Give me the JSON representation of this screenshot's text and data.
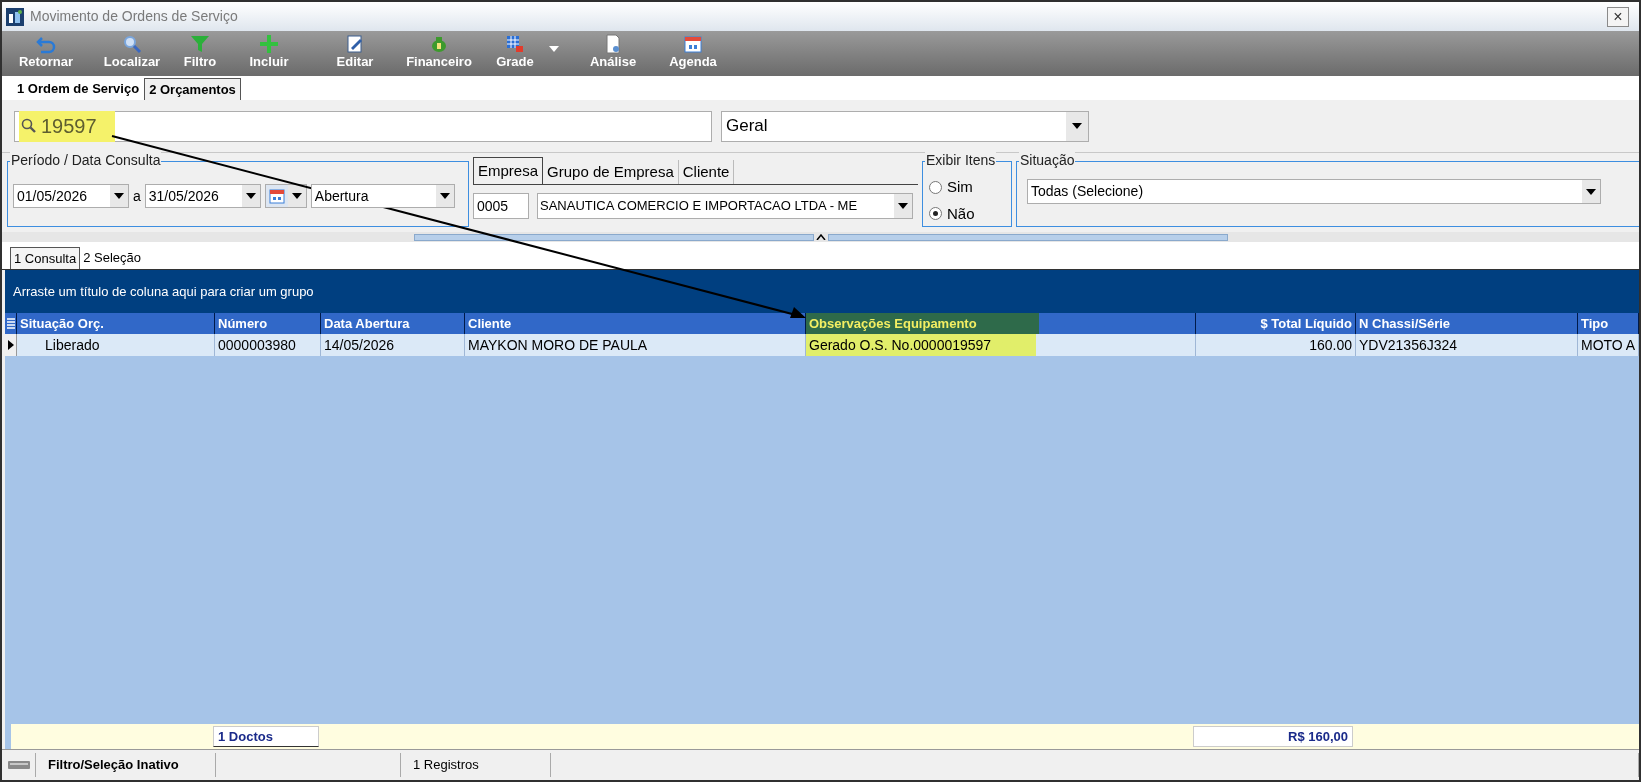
{
  "window": {
    "title": "Movimento de Ordens de Serviço",
    "close": "×"
  },
  "toolbar": [
    {
      "label": "Retornar",
      "dropdown": false
    },
    {
      "label": "Localizar",
      "dropdown": false
    },
    {
      "label": "Filtro",
      "dropdown": false
    },
    {
      "label": "Incluir",
      "dropdown": false
    },
    {
      "label": "Editar",
      "dropdown": false
    },
    {
      "label": "Financeiro",
      "dropdown": false
    },
    {
      "label": "Grade",
      "dropdown": true
    },
    {
      "label": "Análise",
      "dropdown": false
    },
    {
      "label": "Agenda",
      "dropdown": false
    }
  ],
  "tabs": [
    {
      "label": "1 Ordem de Serviço",
      "selected": false
    },
    {
      "label": "2 Orçamentos",
      "selected": true
    }
  ],
  "search": {
    "value": "19597",
    "highlighted": true
  },
  "scope_dropdown": {
    "value": "Geral"
  },
  "period": {
    "title": "Período / Data Consulta",
    "from": "01/05/2026",
    "separator": "a",
    "to": "31/05/2026",
    "date_type": "Abertura"
  },
  "company_tabs": [
    {
      "label": "Empresa",
      "selected": true
    },
    {
      "label": "Grupo de Empresa",
      "selected": false
    },
    {
      "label": "Cliente",
      "selected": false
    }
  ],
  "company": {
    "code": "0005",
    "name": "SANAUTICA COMERCIO E IMPORTACAO LTDA - ME"
  },
  "show_items": {
    "title": "Exibir Itens",
    "options": [
      {
        "label": "Sim",
        "selected": false
      },
      {
        "label": "Não",
        "selected": true
      }
    ]
  },
  "status_filter": {
    "title": "Situação",
    "value": "Todas (Selecione)"
  },
  "view_tabs": [
    {
      "label": "1 Consulta",
      "selected": true
    },
    {
      "label": "2 Seleção",
      "selected": false
    }
  ],
  "group_panel": "Arraste um título de coluna aqui para criar um grupo",
  "table": {
    "columns": [
      {
        "label": "Situação Orç.",
        "highlighted": false
      },
      {
        "label": "Número",
        "highlighted": false
      },
      {
        "label": "Data Abertura",
        "highlighted": false
      },
      {
        "label": "Cliente",
        "highlighted": false
      },
      {
        "label": "Observações Equipamento",
        "highlighted": true
      },
      {
        "label": "$ Total Líquido",
        "highlighted": false
      },
      {
        "label": "N Chassi/Série",
        "highlighted": false
      },
      {
        "label": "Tipo",
        "highlighted": false
      }
    ],
    "rows": [
      {
        "cells": [
          "Liberado",
          "0000003980",
          "14/05/2026",
          "MAYKON MORO DE PAULA",
          "Gerado O.S. No.0000019597",
          "160.00",
          "YDV21356J324",
          "MOTO A"
        ],
        "selected": true
      }
    ]
  },
  "footer": {
    "count": "1 Doctos",
    "total": "R$ 160,00"
  },
  "status_bar": [
    "Filtro/Seleção Inativo",
    "1 Registros"
  ]
}
